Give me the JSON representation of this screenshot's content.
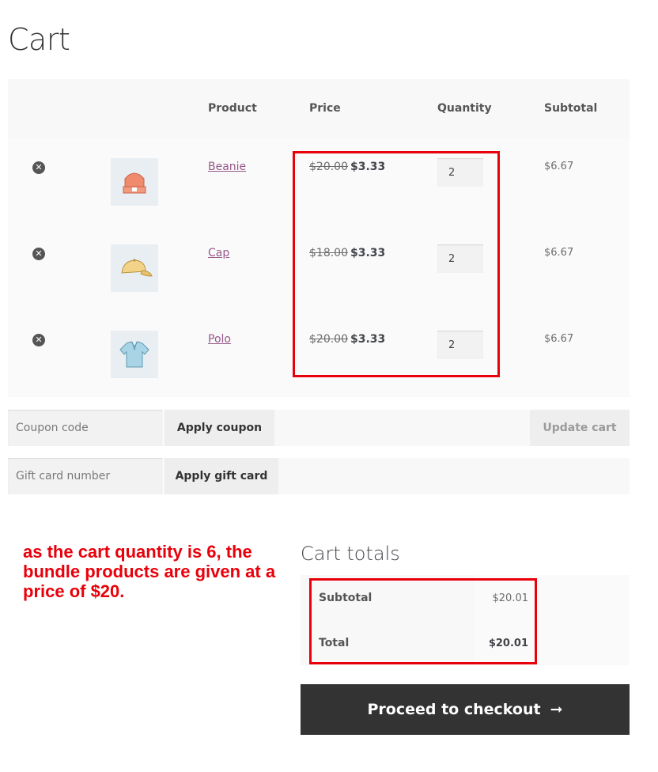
{
  "page": {
    "title": "Cart"
  },
  "table": {
    "headers": {
      "product": "Product",
      "price": "Price",
      "quantity": "Quantity",
      "subtotal": "Subtotal"
    },
    "rows": [
      {
        "name": "Beanie",
        "old_price": "$20.00",
        "new_price": "$3.33",
        "qty": "2",
        "subtotal": "$6.67",
        "icon": "beanie-icon"
      },
      {
        "name": "Cap",
        "old_price": "$18.00",
        "new_price": "$3.33",
        "qty": "2",
        "subtotal": "$6.67",
        "icon": "cap-icon"
      },
      {
        "name": "Polo",
        "old_price": "$20.00",
        "new_price": "$3.33",
        "qty": "2",
        "subtotal": "$6.67",
        "icon": "polo-icon"
      }
    ],
    "remove_glyph": "✕"
  },
  "coupon": {
    "placeholder": "Coupon code",
    "apply_label": "Apply coupon",
    "update_label": "Update cart"
  },
  "giftcard": {
    "placeholder": "Gift card number",
    "apply_label": "Apply gift card"
  },
  "annotation": {
    "text": "as the cart quantity is 6, the bundle products are given at a price of $20.",
    "color": "#e8000a"
  },
  "totals": {
    "title": "Cart totals",
    "subtotal_label": "Subtotal",
    "subtotal_value": "$20.01",
    "total_label": "Total",
    "total_value": "$20.01"
  },
  "checkout": {
    "label": "Proceed to checkout",
    "arrow": "➞"
  },
  "colors": {
    "link": "#96588a",
    "highlight": "#e8000a",
    "checkout_bg": "#333333"
  }
}
